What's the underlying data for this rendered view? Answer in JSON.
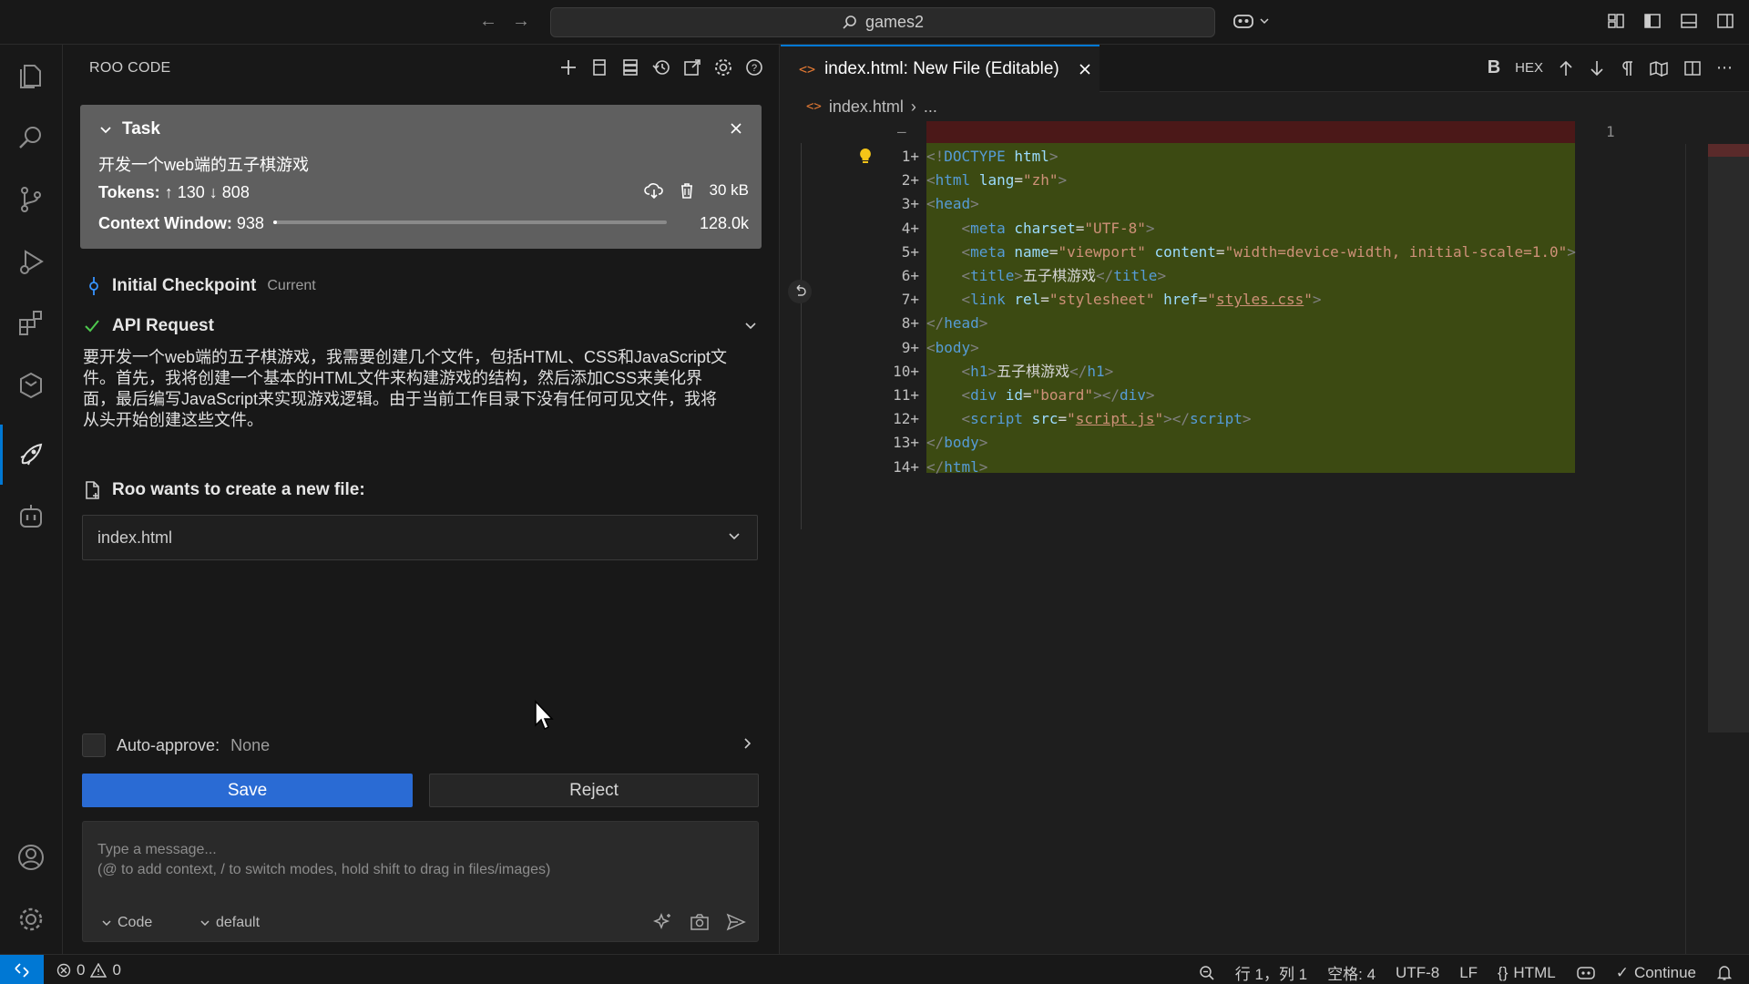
{
  "titlebar": {
    "search_text": "games2"
  },
  "activity": {
    "items": [
      "explorer",
      "search",
      "source-control",
      "run-debug",
      "extensions",
      "remote",
      "roo-code",
      "robot"
    ],
    "bottom": [
      "accounts",
      "settings"
    ]
  },
  "sidepanel": {
    "title": "ROO CODE",
    "task": {
      "header": "Task",
      "text": "开发一个web端的五子棋游戏",
      "tokens_label": "Tokens:",
      "tokens_up": "130",
      "tokens_down": "808",
      "size": "30 kB",
      "context_label": "Context Window:",
      "context_used": "938",
      "context_max": "128.0k",
      "context_fraction": 0.007
    },
    "checkpoint": {
      "title": "Initial Checkpoint",
      "sub": "Current"
    },
    "api_request": {
      "title": "API Request"
    },
    "assistant_lines": [
      "要开发一个web端的五子棋游戏，我需要创建几个文件，包括HTML、CSS和JavaScript文",
      "件。首先，我将创建一个基本的HTML文件来构建游戏的结构，然后添加CSS来美化界",
      "面，最后编写JavaScript来实现游戏逻辑。由于当前工作目录下没有任何可见文件，我将",
      "从头开始创建这些文件。"
    ],
    "create_file": {
      "label": "Roo wants to create a new file:",
      "filename": "index.html"
    },
    "auto_approve": {
      "label": "Auto-approve:",
      "value": "None"
    },
    "buttons": {
      "save": "Save",
      "reject": "Reject"
    },
    "composer": {
      "placeholder_1": "Type a message...",
      "placeholder_2": "(@ to add context, / to switch modes, hold shift to drag in files/images)",
      "mode": "Code",
      "profile": "default"
    }
  },
  "editor": {
    "tab_label": "index.html: New File (Editable)",
    "breadcrumb_file": "index.html",
    "breadcrumb_rest": "...",
    "actions": [
      "B",
      "HEX"
    ],
    "old_line_no": "1",
    "old_line_marker": "—",
    "lines": [
      {
        "no": "1+",
        "html": "<span class='tk-br'>&lt;!</span><span class='tk-doct'>DOCTYPE</span> <span class='tk-attr'>html</span><span class='tk-br'>&gt;</span>"
      },
      {
        "no": "2+",
        "html": "<span class='tk-br'>&lt;</span><span class='tk-tag'>html</span> <span class='tk-attr'>lang</span>=<span class='tk-str'>\"zh\"</span><span class='tk-br'>&gt;</span>"
      },
      {
        "no": "3+",
        "html": "<span class='tk-br'>&lt;</span><span class='tk-tag'>head</span><span class='tk-br'>&gt;</span>"
      },
      {
        "no": "4+",
        "html": "    <span class='tk-br'>&lt;</span><span class='tk-tag'>meta</span> <span class='tk-attr'>charset</span>=<span class='tk-str'>\"UTF-8\"</span><span class='tk-br'>&gt;</span>"
      },
      {
        "no": "5+",
        "html": "    <span class='tk-br'>&lt;</span><span class='tk-tag'>meta</span> <span class='tk-attr'>name</span>=<span class='tk-str'>\"viewport\"</span> <span class='tk-attr'>content</span>=<span class='tk-str'>\"width=device-width, initial-scale=1.0\"</span><span class='tk-br'>&gt;</span>"
      },
      {
        "no": "6+",
        "html": "    <span class='tk-br'>&lt;</span><span class='tk-tag'>title</span><span class='tk-br'>&gt;</span><span class='tk-txt'>五子棋游戏</span><span class='tk-br'>&lt;/</span><span class='tk-tag'>title</span><span class='tk-br'>&gt;</span>"
      },
      {
        "no": "7+",
        "html": "    <span class='tk-br'>&lt;</span><span class='tk-tag'>link</span> <span class='tk-attr'>rel</span>=<span class='tk-str'>\"stylesheet\"</span> <span class='tk-attr'>href</span>=<span class='tk-str'>\"<span class='tk-link'>styles.css</span>\"</span><span class='tk-br'>&gt;</span>"
      },
      {
        "no": "8+",
        "html": "<span class='tk-br'>&lt;/</span><span class='tk-tag'>head</span><span class='tk-br'>&gt;</span>"
      },
      {
        "no": "9+",
        "html": "<span class='tk-br'>&lt;</span><span class='tk-tag'>body</span><span class='tk-br'>&gt;</span>"
      },
      {
        "no": "10+",
        "html": "    <span class='tk-br'>&lt;</span><span class='tk-tag'>h1</span><span class='tk-br'>&gt;</span><span class='tk-txt'>五子棋游戏</span><span class='tk-br'>&lt;/</span><span class='tk-tag'>h1</span><span class='tk-br'>&gt;</span>"
      },
      {
        "no": "11+",
        "html": "    <span class='tk-br'>&lt;</span><span class='tk-tag'>div</span> <span class='tk-attr'>id</span>=<span class='tk-str'>\"board\"</span><span class='tk-br'>&gt;&lt;/</span><span class='tk-tag'>div</span><span class='tk-br'>&gt;</span>"
      },
      {
        "no": "12+",
        "html": "    <span class='tk-br'>&lt;</span><span class='tk-tag'>script</span> <span class='tk-attr'>src</span>=<span class='tk-str'>\"<span class='tk-link'>script.js</span>\"</span><span class='tk-br'>&gt;&lt;/</span><span class='tk-tag'>script</span><span class='tk-br'>&gt;</span>"
      },
      {
        "no": "13+",
        "html": "<span class='tk-br'>&lt;/</span><span class='tk-tag'>body</span><span class='tk-br'>&gt;</span>"
      },
      {
        "no": "14+",
        "html": "<span class='tk-br'>&lt;/</span><span class='tk-tag'>html</span><span class='tk-br'>&gt;</span>"
      }
    ]
  },
  "statusbar": {
    "errors": "0",
    "warnings": "0",
    "position": "行 1，列 1",
    "spaces": "空格: 4",
    "encoding": "UTF-8",
    "eol": "LF",
    "language": "HTML",
    "continue": "Continue"
  },
  "colors": {
    "accent": "#0078d4",
    "save_button": "#2a6bd4",
    "added_bg": "#3c4a12",
    "removed_bg": "#4b1818"
  }
}
